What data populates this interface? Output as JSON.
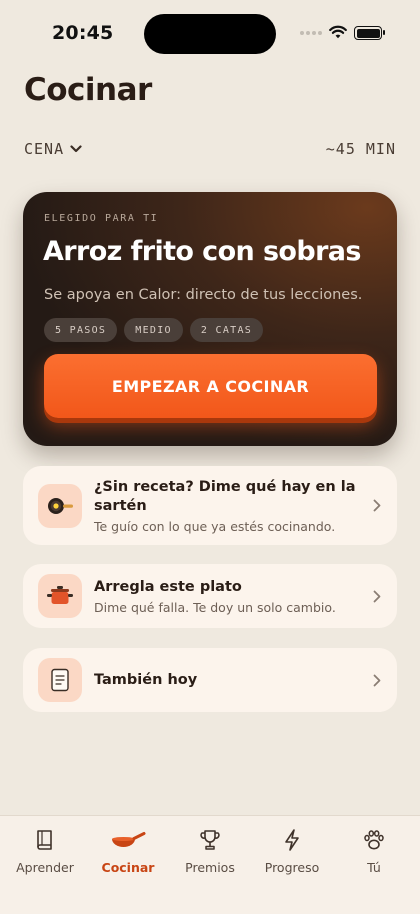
{
  "status_bar": {
    "time": "20:45"
  },
  "header": {
    "title": "Cocinar"
  },
  "meal_selector": {
    "value": "CENA",
    "duration": "~45 MIN"
  },
  "hero": {
    "eyebrow": "ELEGIDO PARA TI",
    "title": "Arroz frito con sobras",
    "subtitle": "Se apoya en Calor: directo de tus lecciones.",
    "chips": [
      "5 PASOS",
      "MEDIO",
      "2 CATAS"
    ],
    "cta_label": "EMPEZAR A COCINAR"
  },
  "options": [
    {
      "icon": "pan-icon",
      "title": "¿Sin receta? Dime qué hay en la sartén",
      "description": "Te guío con lo que ya estés cocinando."
    },
    {
      "icon": "pot-icon",
      "title": "Arregla este plato",
      "description": "Dime qué falla. Te doy un solo cambio."
    },
    {
      "icon": "note-icon",
      "title": "También hoy",
      "description": ""
    }
  ],
  "tabbar": {
    "items": [
      {
        "label": "Aprender",
        "icon": "book-icon"
      },
      {
        "label": "Cocinar",
        "icon": "pan-icon"
      },
      {
        "label": "Premios",
        "icon": "trophy-icon"
      },
      {
        "label": "Progreso",
        "icon": "bolt-icon"
      },
      {
        "label": "Tú",
        "icon": "paw-icon"
      }
    ],
    "active": "Cocinar"
  },
  "colors": {
    "accent": "#F65C1C",
    "background": "#EFE9DF",
    "card": "#FCF4EC",
    "hero_dark": "#241A15"
  }
}
